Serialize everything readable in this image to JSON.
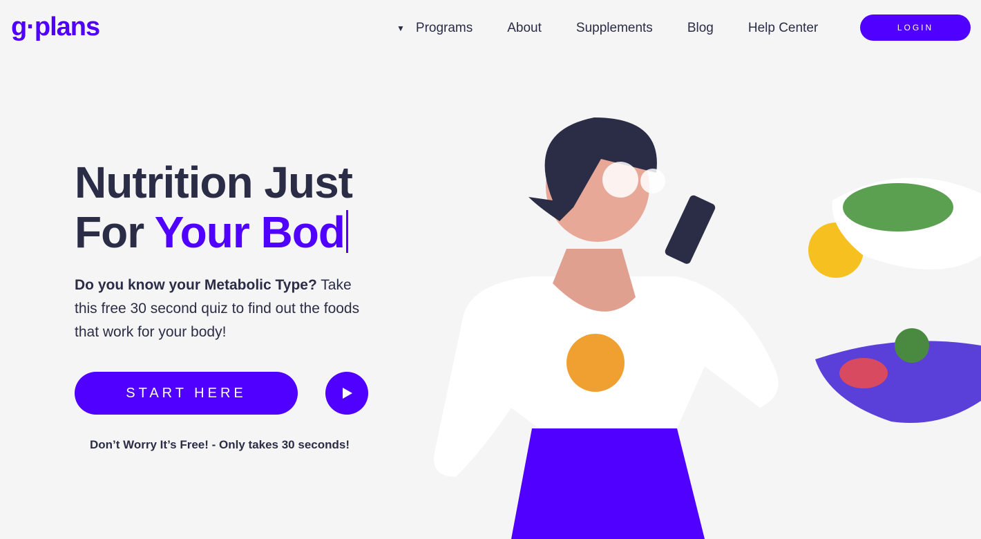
{
  "brand": {
    "logo": "g·plans",
    "accent": "#4f00ff"
  },
  "nav": {
    "items": [
      "Programs",
      "About",
      "Supplements",
      "Blog",
      "Help Center"
    ],
    "login": "LOGIN"
  },
  "hero": {
    "title_line1": "Nutrition Just",
    "title_line2_prefix": "For ",
    "title_line2_accent": "Your Bod",
    "desc_bold": "Do you know your Metabolic Type?",
    "desc_rest": " Take this free 30 second quiz to find out the foods that work for your body!",
    "start": "START HERE",
    "note": "Don’t Worry It’s Free! - Only takes 30 seconds!"
  }
}
